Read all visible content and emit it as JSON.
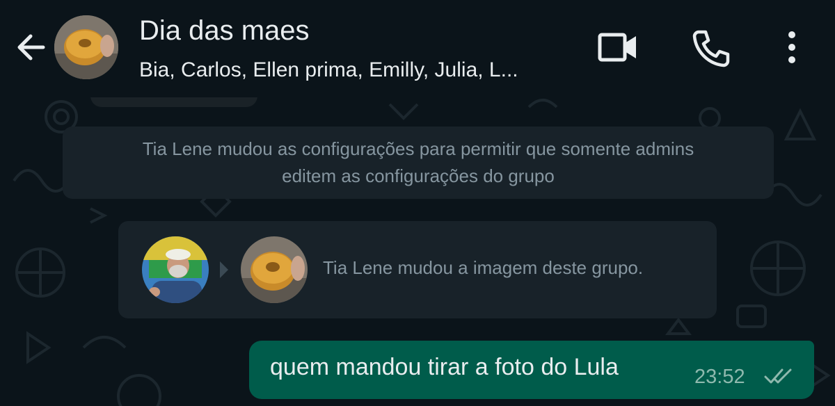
{
  "header": {
    "title": "Dia das maes",
    "participants": "Bia, Carlos, Ellen prima, Emilly, Julia, L...",
    "icons": {
      "back": "arrow-left-icon",
      "video": "video-camera-icon",
      "call": "phone-icon",
      "menu": "kebab-menu-icon"
    }
  },
  "messages": {
    "system_settings": {
      "line1": "Tia Lene mudou as configurações para permitir que somente admins",
      "line2": "editem as configurações do grupo"
    },
    "system_image_change": {
      "text": "Tia Lene mudou a imagem deste grupo."
    },
    "outgoing": {
      "text": "quem mandou tirar a foto do Lula",
      "time": "23:52",
      "status_icon": "double-check-icon"
    }
  },
  "colors": {
    "background": "#0b141a",
    "system_bubble": "#182229",
    "outgoing_bubble": "#005c4b",
    "primary_text": "#e9edef",
    "secondary_text": "#8696a0"
  }
}
